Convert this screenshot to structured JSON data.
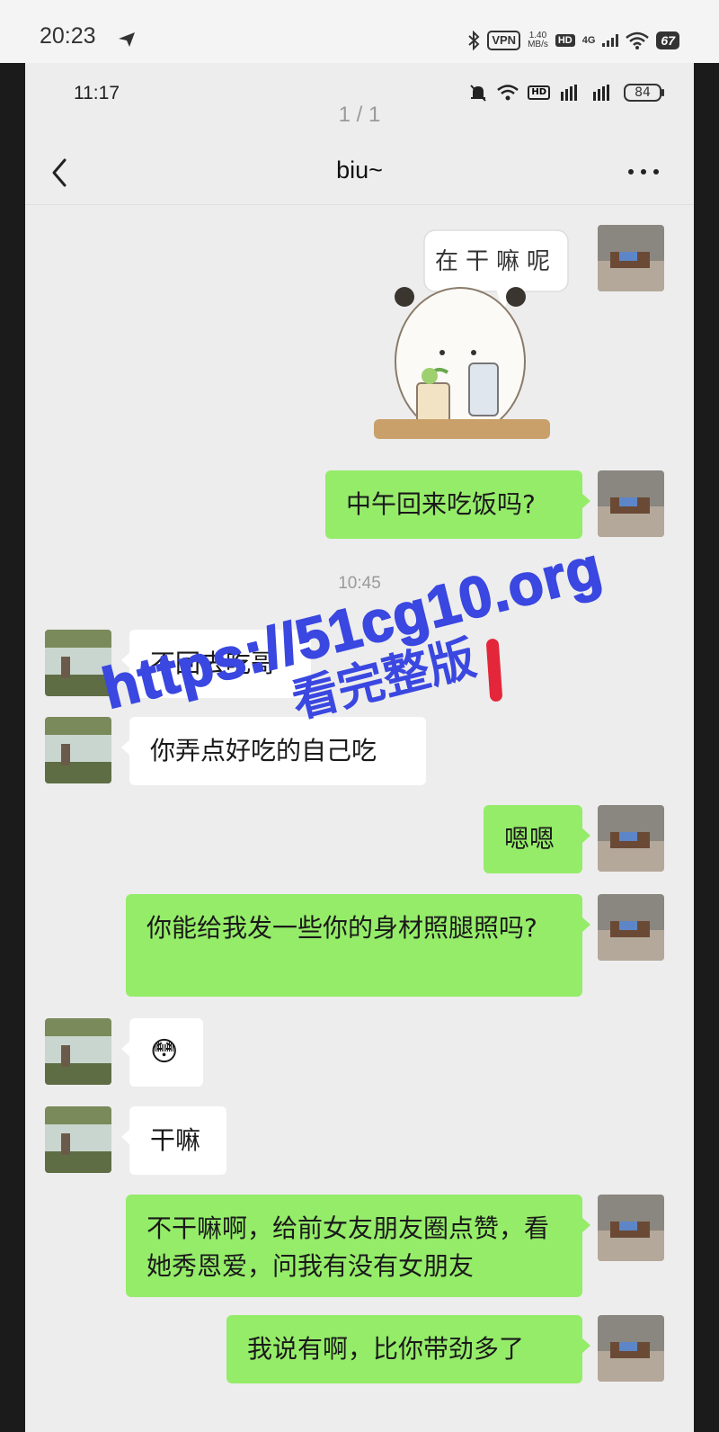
{
  "outer_status": {
    "time": "20:23",
    "vpn": "VPN",
    "speed_value": "1.40",
    "speed_unit": "MB/s",
    "hd": "HD",
    "network": "4G",
    "battery": "67"
  },
  "inner_status": {
    "time": "11:17",
    "hd": "HD",
    "battery": "84"
  },
  "page_indicator": "1 / 1",
  "header": {
    "title": "biu~"
  },
  "sticker": {
    "text": "在干嘛呢"
  },
  "timestamp": "10:45",
  "messages": [
    {
      "from": "self",
      "text": "中午回来吃饭吗?"
    },
    {
      "from": "other",
      "text": "不回去吃哥"
    },
    {
      "from": "other",
      "text": "你弄点好吃的自己吃"
    },
    {
      "from": "self",
      "text": "嗯嗯"
    },
    {
      "from": "self",
      "text": "你能给我发一些你的身材照腿照吗?"
    },
    {
      "from": "other",
      "text": "😳"
    },
    {
      "from": "other",
      "text": "干嘛"
    },
    {
      "from": "self",
      "text": "不干嘛啊，给前女友朋友圈点赞，看她秀恩爱，问我有没有女朋友"
    },
    {
      "from": "self",
      "text": "我说有啊，比你带劲多了"
    }
  ],
  "watermark": {
    "line1": "https://51cg10.org",
    "line2": "看完整版"
  },
  "colors": {
    "self_bubble": "#95ec69",
    "other_bubble": "#ffffff",
    "chat_bg": "#ededed",
    "watermark": "#3a47e0"
  }
}
